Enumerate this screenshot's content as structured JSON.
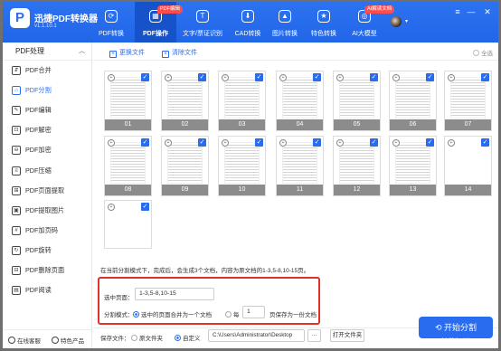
{
  "app": {
    "logo_letter": "P",
    "name": "迅捷PDF转换器",
    "version": "v1.1.10.1"
  },
  "nav": [
    {
      "label": "PDF转换",
      "icon": "pdf-convert-icon",
      "glyph": "⟳"
    },
    {
      "label": "PDF操作",
      "icon": "pdf-operate-icon",
      "glyph": "▦",
      "badge": "PDF编辑"
    },
    {
      "label": "文字/票证识别",
      "icon": "ocr-icon",
      "glyph": "T"
    },
    {
      "label": "CAD转换",
      "icon": "cad-icon",
      "glyph": "⬇"
    },
    {
      "label": "图片转换",
      "icon": "image-icon",
      "glyph": "▲"
    },
    {
      "label": "特色转换",
      "icon": "special-icon",
      "glyph": "★"
    },
    {
      "label": "AI大模型",
      "icon": "ai-icon",
      "glyph": "◎",
      "badge": "AI解读文档"
    }
  ],
  "window_controls": {
    "menu": "≡",
    "minimize": "—",
    "close": "✕"
  },
  "sidebar": {
    "title": "PDF处理",
    "collapse_glyph": "︿",
    "items": [
      {
        "label": "PDF合并",
        "glyph": "⇵"
      },
      {
        "label": "PDF分割",
        "glyph": "⌂"
      },
      {
        "label": "PDF编辑",
        "glyph": "✎"
      },
      {
        "label": "PDF解密",
        "glyph": "⊡"
      },
      {
        "label": "PDF加密",
        "glyph": "⊖"
      },
      {
        "label": "PDF压缩",
        "glyph": "≡"
      },
      {
        "label": "PDF页面提取",
        "glyph": "⊞"
      },
      {
        "label": "PDF提取图片",
        "glyph": "▣"
      },
      {
        "label": "PDF加页码",
        "glyph": "#"
      },
      {
        "label": "PDF旋转",
        "glyph": "↻"
      },
      {
        "label": "PDF删除页面",
        "glyph": "⊟"
      },
      {
        "label": "PDF阅读",
        "glyph": "▤"
      }
    ],
    "footer": {
      "service": "在线客服",
      "product": "特色产品"
    }
  },
  "toolbar": {
    "update_file": "更换文件",
    "clear_file": "清除文件",
    "select_all": "全选"
  },
  "pages": [
    {
      "num": "01",
      "checked": true,
      "grey": true
    },
    {
      "num": "02",
      "checked": true,
      "grey": true
    },
    {
      "num": "03",
      "checked": true,
      "grey": true
    },
    {
      "num": "04",
      "checked": true,
      "grey": true
    },
    {
      "num": "05",
      "checked": true,
      "grey": true
    },
    {
      "num": "06",
      "checked": true,
      "grey": true
    },
    {
      "num": "07",
      "checked": true,
      "grey": true
    },
    {
      "num": "08",
      "checked": true,
      "grey": true
    },
    {
      "num": "09",
      "checked": true,
      "grey": true
    },
    {
      "num": "10",
      "checked": true,
      "grey": true
    },
    {
      "num": "11",
      "checked": true,
      "grey": true
    },
    {
      "num": "12",
      "checked": true,
      "grey": true
    },
    {
      "num": "13",
      "checked": true,
      "grey": true
    },
    {
      "num": "14",
      "checked": true,
      "grey": false
    },
    {
      "num": "",
      "checked": true,
      "grey": false
    }
  ],
  "info_text": "在当前分割模式下，完成后，会生成3个文档，内容为原文档的1-3,5-8,10-15页。",
  "split": {
    "pages_label": "选中页面：",
    "pages_value": "1-3,5-8,10-15",
    "mode_label": "分割模式：",
    "mode_merge": "选中的页面合并为一个文档",
    "mode_every_prefix": "每",
    "mode_every_value": "1",
    "mode_every_suffix": "页保存为一份文档"
  },
  "save": {
    "label": "保存文件：",
    "opt_source": "原文件夹",
    "opt_custom": "自定义",
    "path": "C:\\Users\\Administrator\\Desktop",
    "browse": "···",
    "open_folder": "打开文件夹"
  },
  "start_button": "开始分割",
  "watermark": "CSDN @技能知识…"
}
